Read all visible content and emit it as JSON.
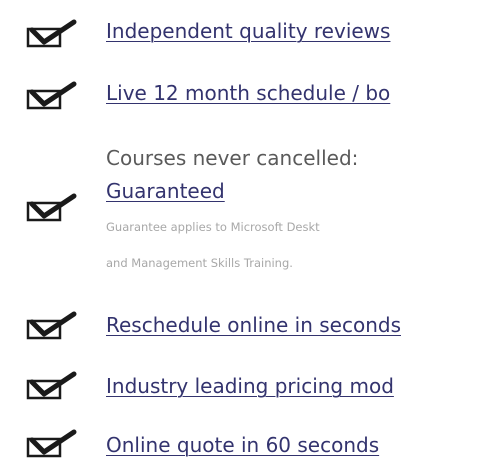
{
  "features": {
    "independent_reviews": "Independent quality reviews",
    "live_schedule": "Live 12 month schedule / bo",
    "never_cancelled_prefix": "Courses never cancelled:",
    "guaranteed": "Guaranteed",
    "guarantee_note_line1": "Guarantee applies to Microsoft Deskt",
    "guarantee_note_line2": "and Management Skills Training.",
    "reschedule": "Reschedule online in seconds",
    "pricing": "Industry leading pricing mod",
    "quote": "Online quote in 60 seconds"
  },
  "colors": {
    "link": "#33336e",
    "checkmark": "#1a1a1a",
    "plain_text": "#5a5a5a",
    "note_text": "#a8a8a8"
  },
  "icons": {
    "bullet": "checkmark-icon"
  }
}
